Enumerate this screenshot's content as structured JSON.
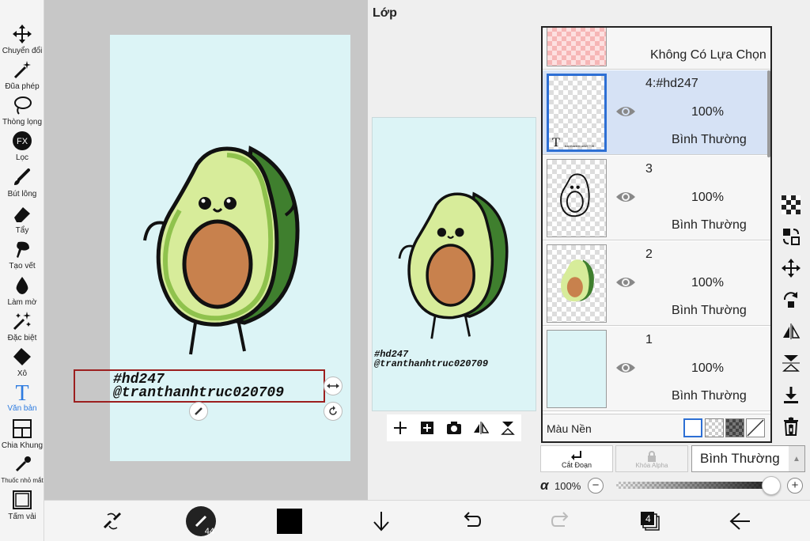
{
  "toolbar": {
    "tools": [
      {
        "label": "Chuyển đổi",
        "icon": "move-arrows-icon"
      },
      {
        "label": "Đũa phép",
        "icon": "magic-wand-icon"
      },
      {
        "label": "Thòng lọng",
        "icon": "lasso-icon"
      },
      {
        "label": "Lọc",
        "icon": "fx-filter-icon"
      },
      {
        "label": "Bút lông",
        "icon": "brush-icon"
      },
      {
        "label": "Tẩy",
        "icon": "eraser-icon"
      },
      {
        "label": "Tạo vết",
        "icon": "smudge-icon"
      },
      {
        "label": "Làm mờ",
        "icon": "blur-drop-icon"
      },
      {
        "label": "Đặc biệt",
        "icon": "sparkle-icon"
      },
      {
        "label": "Xô",
        "icon": "bucket-icon"
      },
      {
        "label": "Văn bản",
        "icon": "text-icon"
      },
      {
        "label": "Chia Khung",
        "icon": "frame-divide-icon"
      },
      {
        "label": "Thuốc nhỏ mắt",
        "icon": "eyedropper-icon"
      },
      {
        "label": "Tấm vải",
        "icon": "canvas-icon"
      }
    ],
    "active_tool": "Văn bản"
  },
  "canvas": {
    "text_line1": "#hd247",
    "text_line2": "@tranthanhtruc020709"
  },
  "layer_panel": {
    "title": "Lớp",
    "selection_layer_label": "Không Có Lựa Chọn",
    "layers": [
      {
        "name": "4:#hd247",
        "opacity": "100%",
        "mode": "Bình Thường",
        "selected": true
      },
      {
        "name": "3",
        "opacity": "100%",
        "mode": "Bình Thường",
        "selected": false
      },
      {
        "name": "2",
        "opacity": "100%",
        "mode": "Bình Thường",
        "selected": false
      },
      {
        "name": "1",
        "opacity": "100%",
        "mode": "Bình Thường",
        "selected": false
      }
    ],
    "thumb_text_layer_label": "tranthanhtruc020709",
    "background_label": "Màu Nền",
    "clip_label": "Cắt Đoạn",
    "alpha_lock_label": "Khóa Alpha",
    "blend_mode": "Bình Thường",
    "alpha_symbol": "α",
    "alpha_value": "100%",
    "alpha_fraction": 1.0,
    "minus": "−",
    "plus": "+"
  },
  "bottombar": {
    "brush_size": "44",
    "layer_count": "4",
    "primary_color": "#000000"
  },
  "colors": {
    "accent": "#2d7be0",
    "selected_layer_bg": "#d6e2f5",
    "artboard_bg": "#dcf4f6",
    "selection_frame": "#9c1f1f"
  }
}
